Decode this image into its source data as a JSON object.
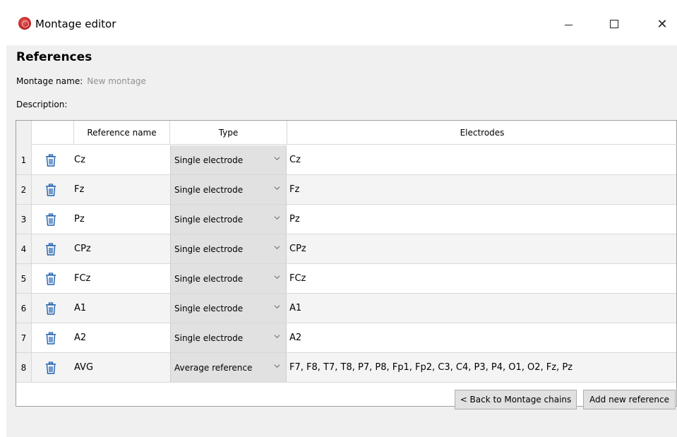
{
  "window": {
    "title": "Montage editor",
    "icon": "app-logo-icon",
    "controls": [
      "minimize-icon",
      "maximize-icon",
      "close-icon"
    ],
    "close_glyph": "✕"
  },
  "page": {
    "section_title": "References",
    "montage_name_label": "Montage name:",
    "montage_name_value": "New montage",
    "description_label": "Description:"
  },
  "table": {
    "headers": {
      "name": "Reference name",
      "type": "Type",
      "electrodes": "Electrodes"
    },
    "rows": [
      {
        "num": "1",
        "name": "Cz",
        "type": "Single electrode",
        "electrodes": "Cz"
      },
      {
        "num": "2",
        "name": "Fz",
        "type": "Single electrode",
        "electrodes": "Fz"
      },
      {
        "num": "3",
        "name": "Pz",
        "type": "Single electrode",
        "electrodes": "Pz"
      },
      {
        "num": "4",
        "name": "CPz",
        "type": "Single electrode",
        "electrodes": "CPz"
      },
      {
        "num": "5",
        "name": "FCz",
        "type": "Single electrode",
        "electrodes": "FCz"
      },
      {
        "num": "6",
        "name": "A1",
        "type": "Single electrode",
        "electrodes": "A1"
      },
      {
        "num": "7",
        "name": "A2",
        "type": "Single electrode",
        "electrodes": "A2"
      },
      {
        "num": "8",
        "name": "AVG",
        "type": "Average reference",
        "electrodes": "F7, F8, T7, T8, P7, P8, Fp1, Fp2, C3, C4, P3, P4, O1, O2, Fz, Pz"
      }
    ],
    "row_icon": "trash-icon",
    "type_icon": "chevron-down-icon"
  },
  "buttons": {
    "back": "< Back to Montage chains",
    "add": "Add new reference"
  },
  "colors": {
    "icon_blue": "#1c5fb0",
    "panel_bg": "#f0f0f0",
    "combo_bg": "#e1e1e1",
    "placeholder_gray": "#909090"
  }
}
